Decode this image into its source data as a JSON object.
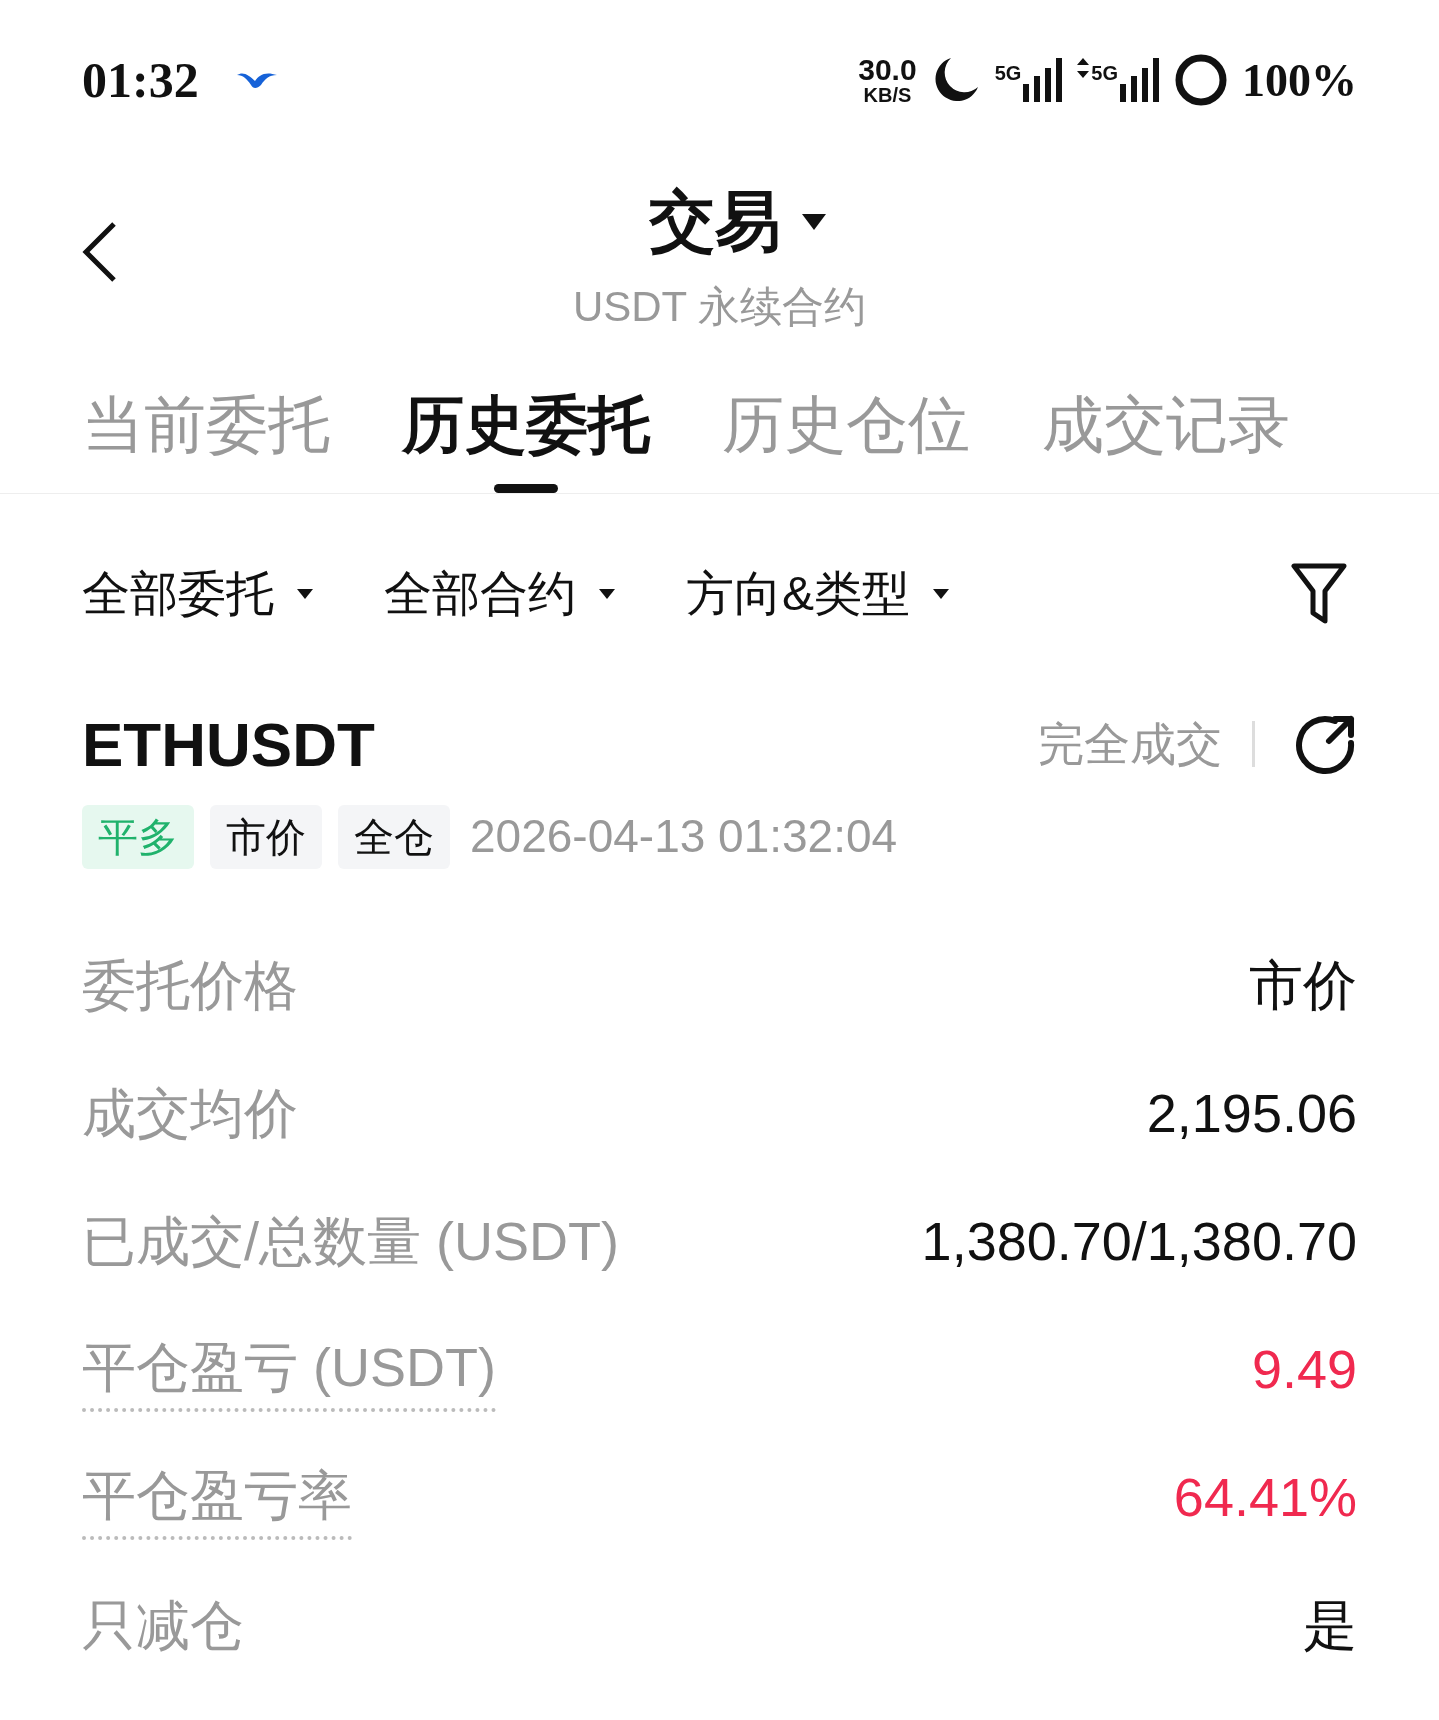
{
  "status_bar": {
    "time": "01:32",
    "speed_value": "30.0",
    "speed_unit": "KB/S",
    "network_1": "5G",
    "network_2": "5G",
    "battery": "100%"
  },
  "header": {
    "title": "交易",
    "subtitle": "USDT 永续合约"
  },
  "tabs": [
    {
      "label": "当前委托",
      "selected": false
    },
    {
      "label": "历史委托",
      "selected": true
    },
    {
      "label": "历史仓位",
      "selected": false
    },
    {
      "label": "成交记录",
      "selected": false
    }
  ],
  "filters": [
    "全部委托",
    "全部合约",
    "方向&类型"
  ],
  "order": {
    "symbol": "ETHUSDT",
    "status": "完全成交",
    "time": "2026-04-13 01:32:04",
    "tags": [
      {
        "label": "平多",
        "kind": "side"
      },
      {
        "label": "市价",
        "kind": "plain"
      },
      {
        "label": "全仓",
        "kind": "plain"
      }
    ],
    "rows": [
      {
        "label": "委托价格",
        "value": "市价",
        "dotted": false,
        "color": "#111111"
      },
      {
        "label": "成交均价",
        "value": "2,195.06",
        "dotted": false,
        "color": "#111111"
      },
      {
        "label": "已成交/总数量 (USDT)",
        "value": "1,380.70/1,380.70",
        "dotted": false,
        "color": "#111111"
      },
      {
        "label": "平仓盈亏 (USDT)",
        "value": "9.49",
        "dotted": true,
        "color": "#f0294f"
      },
      {
        "label": "平仓盈亏率",
        "value": "64.41%",
        "dotted": true,
        "color": "#f0294f"
      },
      {
        "label": "只减仓",
        "value": "是",
        "dotted": false,
        "color": "#111111"
      }
    ]
  }
}
